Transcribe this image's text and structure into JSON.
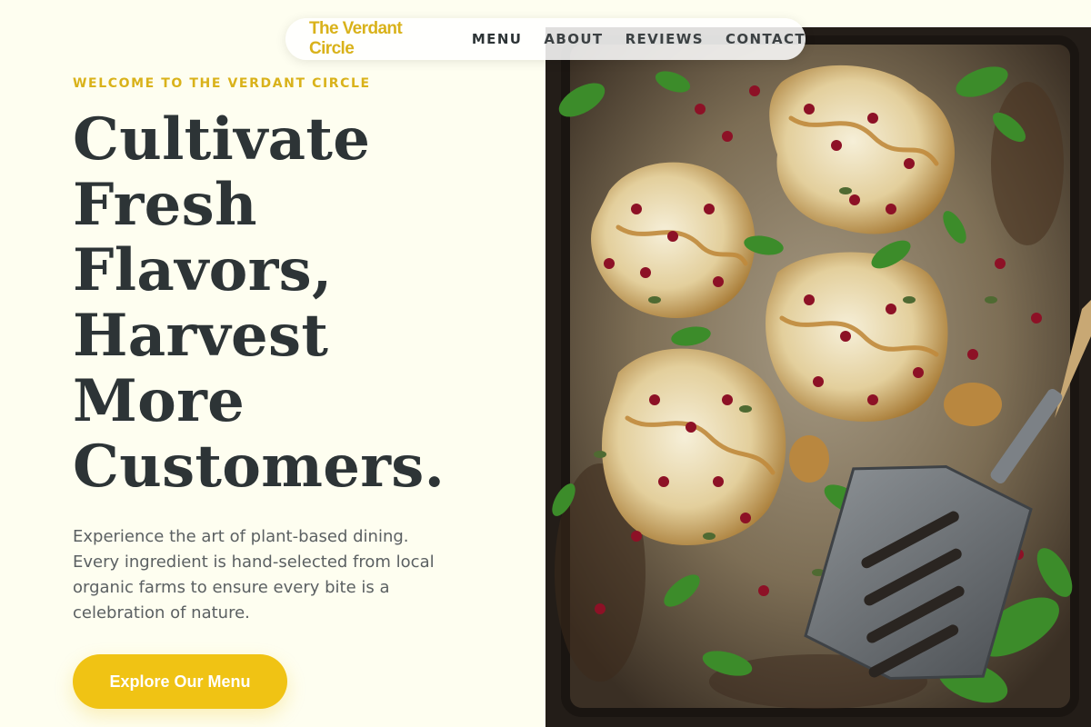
{
  "nav": {
    "brand": "The Verdant Circle",
    "links": [
      "MENU",
      "ABOUT",
      "REVIEWS",
      "CONTACT"
    ]
  },
  "hero": {
    "eyebrow": "WELCOME TO THE VERDANT CIRCLE",
    "headline_lines": [
      "Cultivate",
      "Fresh",
      "Flavors,",
      "Harvest",
      "More",
      "Customers."
    ],
    "description": "Experience the art of plant-based dining. Every ingredient is hand-selected from local organic farms to ensure every bite is a celebration of nature.",
    "cta_label": "Explore Our Menu"
  },
  "colors": {
    "accent": "#f0c314",
    "brand_text": "#d9b21a",
    "heading": "#2d3436",
    "background": "#fefef0"
  }
}
